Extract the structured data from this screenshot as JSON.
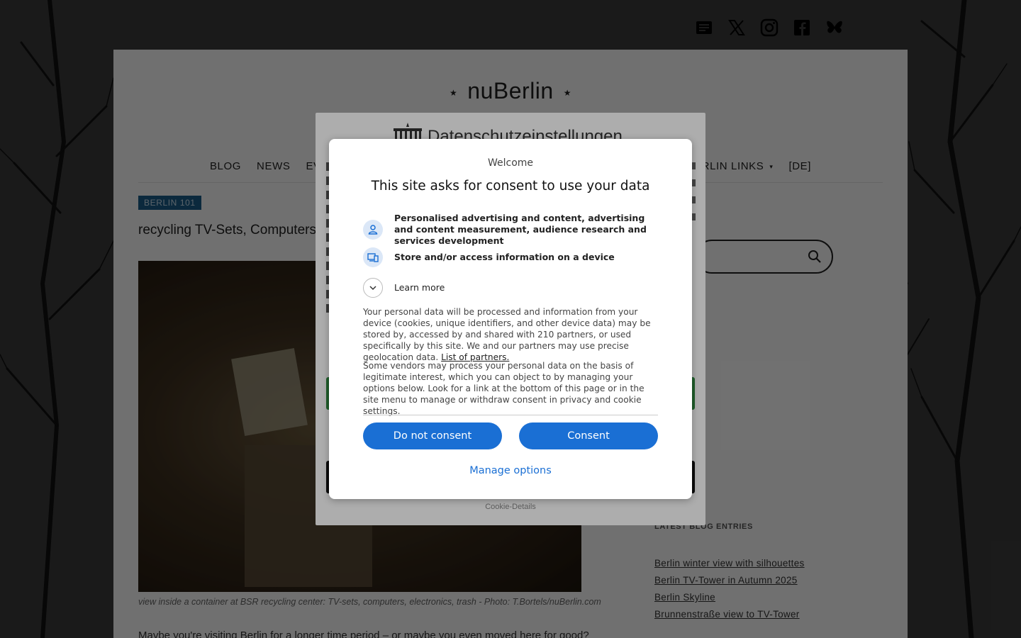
{
  "site": {
    "title": "nuBerlin",
    "star_glyph": "★"
  },
  "social": [
    "newsletter-icon",
    "x-icon",
    "instagram-icon",
    "facebook-icon",
    "bluesky-icon"
  ],
  "nav": {
    "items": [
      "BLOG",
      "NEWS",
      "EVENT",
      "BERLIN LINKS",
      "[DE]"
    ],
    "caret_glyph": "▾"
  },
  "post": {
    "category": "BERLIN 101",
    "title": "recycling TV-Sets, Computers, Ele",
    "caption": "view inside a container at BSR recycling center: TV-sets, computers, electronics, trash - Photo: T.Bortels/nuBerlin.com",
    "body_start": "Maybe you're visiting Berlin for a longer time period – or maybe you even moved here for good?"
  },
  "sidebar": {
    "latest_heading": "LATEST BLOG ENTRIES",
    "latest": [
      "Berlin winter view with silhouettes",
      "Berlin TV-Tower in Autumn 2025",
      "Berlin Skyline",
      "Brunnenstraße view to TV-Tower"
    ]
  },
  "privacy_dialog": {
    "title": "Datenschutzeinstellungen",
    "cookie_details": "Cookie-Details"
  },
  "consent": {
    "welcome": "Welcome",
    "heading": "This site asks for consent to use your data",
    "purposes": [
      "Personalised advertising and content, advertising and content measurement, audience research and services development",
      "Store and/or access information on a device"
    ],
    "learn_more": "Learn more",
    "para1": "Your personal data will be processed and information from your device (cookies, unique identifiers, and other device data) may be stored by, accessed by and shared with 210 partners, or used specifically by this site. We and our partners may use precise geolocation data.",
    "partners_link": "List of partners.",
    "para2": "Some vendors may process your personal data on the basis of legitimate interest, which you can object to by managing your options below. Look for a link at the bottom of this page or in the site menu to manage or withdraw consent in privacy and cookie settings.",
    "do_not_consent": "Do not consent",
    "consent": "Consent",
    "manage_options": "Manage options",
    "accent": "#1a6fd4"
  }
}
